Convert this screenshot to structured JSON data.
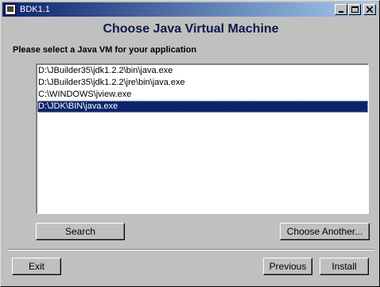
{
  "window": {
    "title": "BDK1.1",
    "controls": [
      "minimize-icon",
      "maximize-icon",
      "close-icon"
    ]
  },
  "heading": "Choose Java Virtual Machine",
  "prompt": "Please select a Java VM for your application",
  "vm_list": {
    "items": [
      "D:\\JBuilder35\\jdk1.2.2\\bin\\java.exe",
      "D:\\JBuilder35\\jdk1.2.2\\jre\\bin\\java.exe",
      "C:\\WINDOWS\\jview.exe",
      "D:\\JDK\\BIN\\java.exe"
    ],
    "selected_index": 3
  },
  "buttons": {
    "search": "Search",
    "choose_another": "Choose Another...",
    "exit": "Exit",
    "previous": "Previous",
    "install": "Install"
  },
  "colors": {
    "titlebar_start": "#0a246a",
    "titlebar_end": "#a6caf0",
    "heading": "#0b1a4a",
    "selection": "#0a246a"
  }
}
